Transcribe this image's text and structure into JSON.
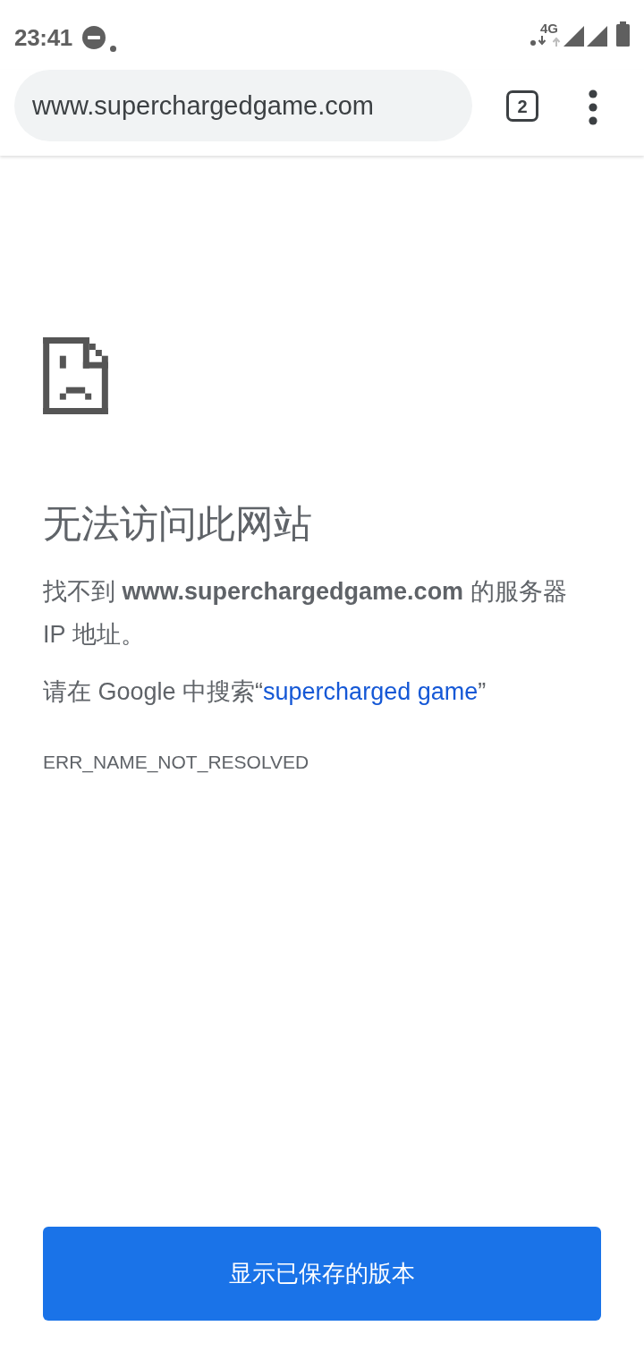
{
  "status_bar": {
    "time": "23:41",
    "network": "4G"
  },
  "toolbar": {
    "url": "www.superchargedgame.com",
    "tab_count": "2"
  },
  "error": {
    "title": "无法访问此网站",
    "message": "找不到 **www.superchargedgame.com** 的服务器 IP 地址。",
    "search_prefix": "请在 Google 中搜索“",
    "search_link": "supercharged game",
    "search_suffix": "”",
    "code": "ERR_NAME_NOT_RESOLVED"
  },
  "action": {
    "label": "显示已保存的版本"
  }
}
